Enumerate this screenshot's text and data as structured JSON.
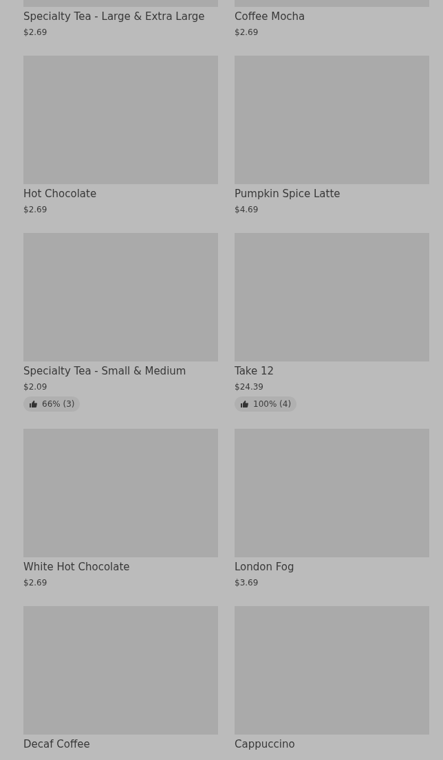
{
  "items": [
    {
      "name": "Specialty Tea - Large & Extra Large",
      "price": "$2.69"
    },
    {
      "name": "Coffee Mocha",
      "price": "$2.69"
    },
    {
      "name": "Hot Chocolate",
      "price": "$2.69"
    },
    {
      "name": "Pumpkin Spice Latte",
      "price": "$4.69"
    },
    {
      "name": "Specialty Tea - Small & Medium",
      "price": "$2.09",
      "rating": "66% (3)"
    },
    {
      "name": "Take 12",
      "price": "$24.39",
      "rating": "100% (4)"
    },
    {
      "name": "White Hot Chocolate",
      "price": "$2.69"
    },
    {
      "name": "London Fog",
      "price": "$3.69"
    },
    {
      "name": "Decaf Coffee"
    },
    {
      "name": "Cappuccino"
    }
  ]
}
